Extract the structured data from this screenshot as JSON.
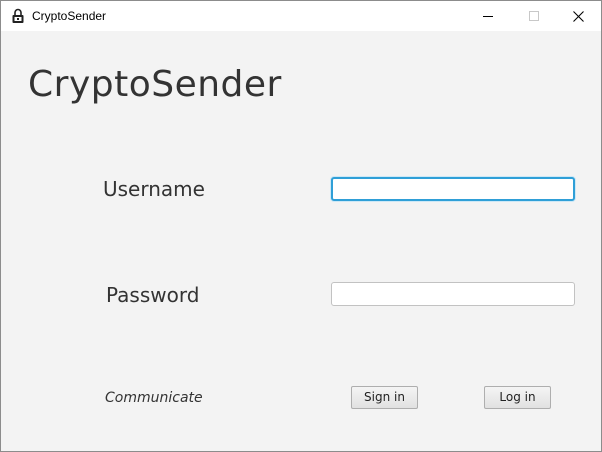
{
  "window": {
    "title": "CryptoSender",
    "app_icon": "padlock-icon",
    "controls": {
      "minimize_icon": "minimize-icon",
      "maximize_icon": "maximize-icon",
      "close_icon": "close-icon"
    }
  },
  "main": {
    "heading": "CryptoSender",
    "username_label": "Username",
    "username_value": "",
    "password_label": "Password",
    "password_value": "",
    "communicate_label": "Communicate",
    "signin_label": "Sign in",
    "login_label": "Log in"
  },
  "colors": {
    "focus_border": "#2f9fd7",
    "background": "#f3f3f3",
    "titlebar": "#ffffff"
  }
}
